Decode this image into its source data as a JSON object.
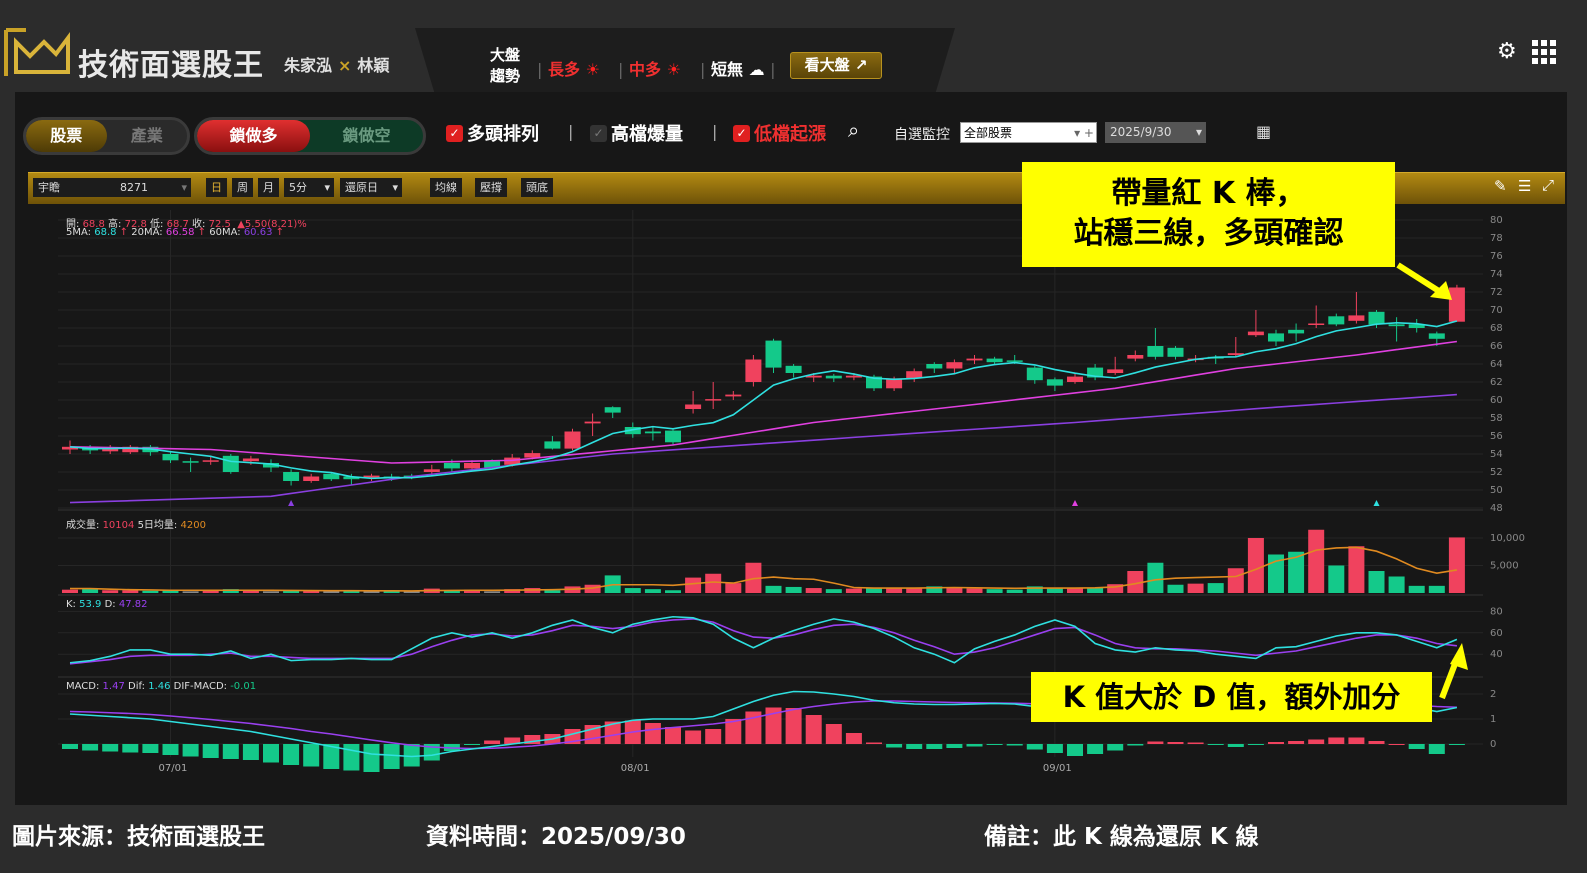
{
  "header": {
    "title": "技術面選股王",
    "author1": "朱家泓",
    "x": "×",
    "author2": "林穎",
    "trend_label": "大盤趨勢",
    "long": "長多",
    "mid": "中多",
    "short": "短無",
    "kandapan": "看大盤"
  },
  "controls": {
    "stock": "股票",
    "industry": "產業",
    "lock_long": "鎖做多",
    "lock_short": "鎖做空",
    "filters": [
      {
        "label": "多頭排列",
        "checked": true
      },
      {
        "label": "高檔爆量",
        "checked": false
      },
      {
        "label": "低檔起漲",
        "checked": true
      }
    ],
    "watch_label": "自選監控",
    "watch_value": "全部股票",
    "date_value": "2025/9/30"
  },
  "toolbar": {
    "name": "宇瞻",
    "code": "8271",
    "day": "日",
    "week": "周",
    "month": "月",
    "interval": "5分",
    "restore": "還原日",
    "ma": "均線",
    "sr": "壓撐",
    "top_bottom": "頭底"
  },
  "info": {
    "open_l": "開:",
    "open": "68.8",
    "high_l": "高:",
    "high": "72.8",
    "low_l": "低:",
    "low": "68.7",
    "close_l": "收:",
    "close": "72.5",
    "change": "▲5.50(8.21)%",
    "ma5_l": "5MA:",
    "ma5": "68.8",
    "ma20_l": "20MA:",
    "ma20": "66.58",
    "ma60_l": "60MA:",
    "ma60": "60.63",
    "up": "↑",
    "vol_l": "成交量:",
    "vol": "10104",
    "vol5_l": "5日均量:",
    "vol5": "4200",
    "k_l": "K:",
    "k": "53.9",
    "d_l": "D:",
    "d": "47.82",
    "macd_l": "MACD:",
    "macd": "1.47",
    "dif_l": "Dif:",
    "dif": "1.46",
    "osc_l": "DIF-MACD:",
    "osc": "-0.01"
  },
  "notes": {
    "note1_line1": "帶量紅 K 棒，",
    "note1_line2": "站穩三線，多頭確認",
    "note2": "K 值大於 D 值，額外加分"
  },
  "caption": {
    "source": "圖片來源：技術面選股王",
    "time": "資料時間：2025/09/30",
    "remark": "備註：此 K 線為還原 K 線"
  },
  "colors": {
    "up": "#f0425e",
    "down": "#14c98a",
    "ma5": "#2fe0e0",
    "ma20": "#e040e0",
    "ma60": "#8a3fe0",
    "k": "#2fe0e0",
    "d": "#9a40f0",
    "gold": "#b38a12"
  },
  "chart_data": {
    "type": "candlestick",
    "price_ticks": [
      48,
      50,
      52,
      54,
      56,
      58,
      60,
      62,
      64,
      66,
      68,
      70,
      72,
      74,
      76,
      78,
      80
    ],
    "vol_ticks": [
      "5,000",
      "10,000"
    ],
    "vol_tick_values": [
      5000,
      10000
    ],
    "kd_ticks": [
      40,
      60,
      80
    ],
    "macd_ticks": [
      0,
      1,
      2
    ],
    "date_labels": [
      {
        "i": 5,
        "label": "07/01"
      },
      {
        "i": 28,
        "label": "08/01"
      },
      {
        "i": 49,
        "label": "09/01"
      }
    ],
    "candles": [
      [
        54.5,
        54.8,
        55.5,
        54
      ],
      [
        54.7,
        54.4,
        55,
        54
      ],
      [
        54.3,
        54.6,
        55,
        54
      ],
      [
        54.2,
        54.8,
        55,
        54
      ],
      [
        54.8,
        54.2,
        55,
        53.8
      ],
      [
        54,
        53.3,
        54.2,
        53
      ],
      [
        53.2,
        53.1,
        53.6,
        52
      ],
      [
        53.2,
        53.3,
        53.8,
        52.8
      ],
      [
        53.8,
        52,
        54,
        51.8
      ],
      [
        53.2,
        53.5,
        53.8,
        52.8
      ],
      [
        53,
        52.5,
        53.4,
        52
      ],
      [
        52,
        51,
        52.3,
        50.5
      ],
      [
        51,
        51.5,
        51.8,
        50.8
      ],
      [
        51.8,
        51.2,
        52,
        51
      ],
      [
        51.5,
        51.2,
        51.8,
        50.5
      ],
      [
        51.4,
        51.6,
        51.8,
        51
      ],
      [
        51.5,
        51.4,
        51.8,
        51
      ],
      [
        51.6,
        51.4,
        51.8,
        51.2
      ],
      [
        52,
        52.3,
        52.8,
        51.8
      ],
      [
        53,
        52.4,
        53.4,
        52
      ],
      [
        52.4,
        53,
        53.3,
        52.2
      ],
      [
        53.2,
        52.5,
        53.4,
        52.3
      ],
      [
        52.8,
        53.6,
        54,
        52.6
      ],
      [
        53.6,
        54.1,
        54.4,
        53.4
      ],
      [
        55.4,
        54.6,
        56,
        54.5
      ],
      [
        54.6,
        56.5,
        56.8,
        54.4
      ],
      [
        57.4,
        57.6,
        58.5,
        56
      ],
      [
        59.2,
        58.6,
        59.3,
        58
      ],
      [
        57,
        56.2,
        57.5,
        55.8
      ],
      [
        56.5,
        56.3,
        57,
        55.5
      ],
      [
        56.6,
        55.3,
        56.8,
        55
      ],
      [
        59,
        59.5,
        61,
        58.5
      ],
      [
        60,
        60.1,
        62,
        59
      ],
      [
        60.4,
        60.6,
        61,
        60
      ],
      [
        62,
        64.5,
        65,
        61.5
      ],
      [
        66.6,
        63.6,
        66.8,
        63
      ],
      [
        63.8,
        63,
        64,
        62.5
      ],
      [
        62.5,
        62.7,
        63,
        62
      ],
      [
        62.7,
        62.4,
        62.9,
        62
      ],
      [
        62.5,
        62.7,
        63,
        62.2
      ],
      [
        62.6,
        61.3,
        62.8,
        61
      ],
      [
        61.3,
        62.4,
        62.6,
        61
      ],
      [
        62.4,
        63.2,
        63.5,
        62
      ],
      [
        64,
        63.5,
        64.2,
        63
      ],
      [
        63.5,
        64.2,
        64.5,
        63
      ],
      [
        64.4,
        64.6,
        65,
        64
      ],
      [
        64.6,
        64.2,
        64.8,
        64
      ],
      [
        64.4,
        64.3,
        65,
        64
      ],
      [
        63.6,
        62.2,
        63.8,
        61.8
      ],
      [
        62.3,
        61.6,
        62.5,
        61
      ],
      [
        62,
        62.6,
        63,
        61.8
      ],
      [
        63.6,
        62.5,
        64,
        62.2
      ],
      [
        63,
        63.4,
        64.8,
        62.8
      ],
      [
        64.6,
        65,
        65.5,
        64.3
      ],
      [
        66,
        64.8,
        68,
        64.5
      ],
      [
        65.8,
        64.8,
        66,
        64.5
      ],
      [
        64.5,
        64.6,
        65,
        64.2
      ],
      [
        64.8,
        64.6,
        65,
        64
      ],
      [
        65,
        65.2,
        67,
        64.8
      ],
      [
        67.2,
        67.6,
        70,
        67
      ],
      [
        67.4,
        66.5,
        67.8,
        66
      ],
      [
        67.8,
        67.4,
        68.5,
        66.5
      ],
      [
        68.4,
        68.5,
        70.5,
        68
      ],
      [
        69.3,
        68.4,
        69.6,
        68.2
      ],
      [
        68.8,
        69.4,
        72,
        68.5
      ],
      [
        69.8,
        68.4,
        70,
        68
      ],
      [
        68.4,
        68.2,
        69.2,
        66.5
      ],
      [
        68.4,
        68,
        69,
        67.5
      ],
      [
        67.4,
        66.8,
        67.6,
        66
      ],
      [
        68.7,
        72.5,
        72.8,
        68.7
      ]
    ],
    "ma20_points": [
      [
        0,
        54.8
      ],
      [
        7,
        54.5
      ],
      [
        16,
        53
      ],
      [
        22,
        53.3
      ],
      [
        30,
        55
      ],
      [
        37,
        57.5
      ],
      [
        45,
        59.5
      ],
      [
        52,
        61.3
      ],
      [
        58,
        63.5
      ],
      [
        64,
        65
      ],
      [
        69,
        66.5
      ]
    ],
    "ma60_points": [
      [
        0,
        48.6
      ],
      [
        10,
        49.3
      ],
      [
        17,
        51.5
      ],
      [
        27,
        54
      ],
      [
        40,
        56
      ],
      [
        50,
        57.5
      ],
      [
        60,
        59.2
      ],
      [
        69,
        60.6
      ]
    ],
    "volume": [
      600,
      900,
      500,
      500,
      400,
      600,
      300,
      500,
      700,
      400,
      300,
      500,
      400,
      300,
      400,
      300,
      500,
      300,
      800,
      400,
      600,
      300,
      700,
      900,
      500,
      1200,
      1500,
      3200,
      900,
      700,
      500,
      2800,
      3500,
      1800,
      5500,
      1300,
      1100,
      900,
      700,
      800,
      1000,
      900,
      1000,
      1200,
      900,
      800,
      700,
      600,
      1200,
      1000,
      900,
      1000,
      1600,
      4000,
      5500,
      1500,
      1700,
      1800,
      4500,
      10000,
      7000,
      7500,
      11500,
      5000,
      8500,
      4000,
      3000,
      1300,
      1300,
      10104
    ],
    "vol_ma5": [
      800,
      800,
      700,
      600,
      550,
      500,
      500,
      480,
      500,
      500,
      480,
      460,
      450,
      420,
      420,
      400,
      400,
      380,
      450,
      460,
      500,
      480,
      520,
      560,
      600,
      700,
      900,
      1500,
      1500,
      1500,
      1400,
      1700,
      2000,
      1800,
      2600,
      2900,
      2600,
      2500,
      1800,
      1000,
      900,
      900,
      900,
      950,
      1000,
      950,
      900,
      850,
      900,
      900,
      900,
      950,
      1100,
      1700,
      2400,
      2700,
      2800,
      2900,
      3000,
      4300,
      5800,
      6500,
      7800,
      8200,
      8300,
      7600,
      6200,
      4500,
      3600,
      4200
    ],
    "k": [
      32,
      34,
      38,
      44,
      44,
      40,
      40,
      39,
      43,
      36,
      40,
      34,
      35,
      35,
      36,
      35,
      35,
      45,
      55,
      60,
      56,
      60,
      55,
      60,
      67,
      72,
      65,
      60,
      68,
      72,
      75,
      74,
      68,
      55,
      46,
      55,
      62,
      68,
      73,
      70,
      64,
      56,
      46,
      40,
      32,
      45,
      52,
      58,
      66,
      72,
      66,
      50,
      44,
      42,
      46,
      44,
      43,
      40,
      38,
      36,
      46,
      47,
      52,
      57,
      60,
      60,
      58,
      52,
      46,
      53.9
    ],
    "d": [
      31,
      33,
      35,
      38,
      39,
      39,
      39,
      40,
      41,
      38,
      38,
      37,
      36,
      36,
      36,
      36,
      36,
      40,
      47,
      53,
      58,
      59,
      57,
      58,
      62,
      67,
      66,
      64,
      66,
      70,
      72,
      73,
      70,
      62,
      56,
      55,
      58,
      63,
      67,
      68,
      65,
      60,
      53,
      47,
      40,
      42,
      46,
      52,
      58,
      64,
      65,
      58,
      50,
      46,
      45,
      45,
      44,
      43,
      41,
      39,
      41,
      43,
      47,
      51,
      55,
      58,
      58,
      55,
      50,
      47.82
    ],
    "dif": [
      1.2,
      1.15,
      1.1,
      1.05,
      1,
      0.9,
      0.8,
      0.7,
      0.6,
      0.5,
      0.35,
      0.2,
      0.05,
      -0.1,
      -0.25,
      -0.4,
      -0.45,
      -0.5,
      -0.45,
      -0.3,
      -0.2,
      -0.1,
      0,
      0.1,
      0.2,
      0.4,
      0.6,
      0.8,
      0.95,
      1.0,
      1.0,
      1.0,
      1.1,
      1.4,
      1.7,
      1.95,
      2.1,
      2.08,
      2.0,
      1.9,
      1.75,
      1.65,
      1.6,
      1.58,
      1.58,
      1.6,
      1.62,
      1.6,
      1.5,
      1.4,
      1.3,
      1.3,
      1.35,
      1.45,
      1.55,
      1.55,
      1.55,
      1.5,
      1.45,
      1.5,
      1.55,
      1.58,
      1.62,
      1.68,
      1.7,
      1.65,
      1.58,
      1.45,
      1.3,
      1.46
    ],
    "macd": [
      1.3,
      1.28,
      1.25,
      1.22,
      1.18,
      1.12,
      1.05,
      0.98,
      0.9,
      0.82,
      0.72,
      0.62,
      0.5,
      0.4,
      0.28,
      0.16,
      0.05,
      -0.05,
      -0.12,
      -0.16,
      -0.18,
      -0.17,
      -0.13,
      -0.08,
      0,
      0.1,
      0.22,
      0.35,
      0.48,
      0.58,
      0.66,
      0.73,
      0.8,
      0.9,
      1.05,
      1.22,
      1.38,
      1.5,
      1.6,
      1.68,
      1.72,
      1.72,
      1.7,
      1.68,
      1.66,
      1.65,
      1.64,
      1.63,
      1.61,
      1.58,
      1.54,
      1.5,
      1.48,
      1.48,
      1.5,
      1.51,
      1.52,
      1.52,
      1.51,
      1.51,
      1.51,
      1.52,
      1.53,
      1.55,
      1.57,
      1.59,
      1.58,
      1.55,
      1.5,
      1.47
    ],
    "signals": [
      {
        "i": 11,
        "color": "#8a3fe0"
      },
      {
        "i": 50,
        "color": "#e040e0"
      },
      {
        "i": 65,
        "color": "#2fe0e0"
      }
    ]
  }
}
